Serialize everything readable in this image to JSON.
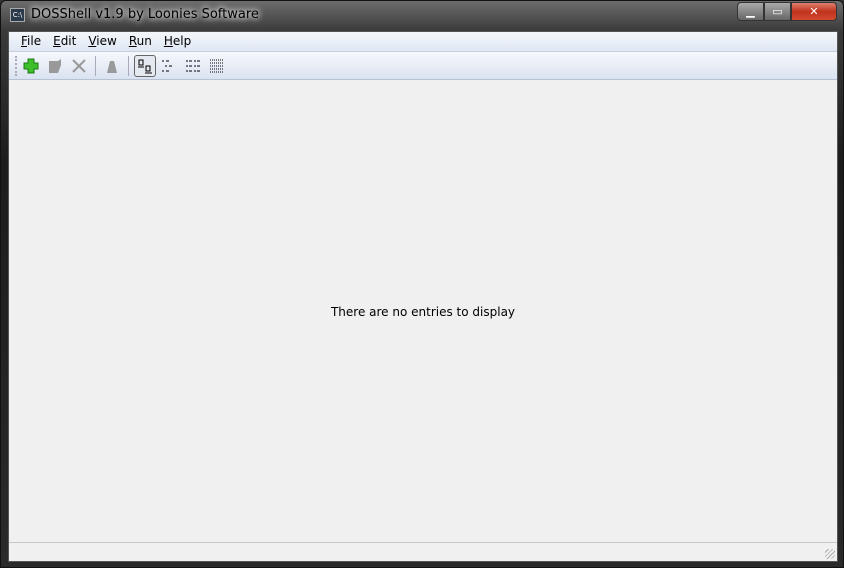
{
  "window": {
    "title": "DOSShell v1.9 by Loonies Software",
    "icon_text": "C:\\"
  },
  "menu": [
    {
      "label": "File",
      "key": "F",
      "rest": "ile"
    },
    {
      "label": "Edit",
      "key": "E",
      "rest": "dit"
    },
    {
      "label": "View",
      "key": "V",
      "rest": "iew"
    },
    {
      "label": "Run",
      "key": "R",
      "rest": "un"
    },
    {
      "label": "Help",
      "key": "H",
      "rest": "elp"
    }
  ],
  "content": {
    "empty_message": "There are no entries to display"
  }
}
